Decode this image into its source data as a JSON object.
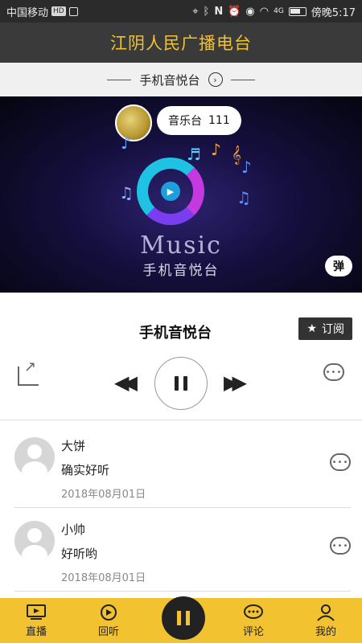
{
  "statusbar": {
    "carrier": "中国移动",
    "hd": "HD",
    "time": "傍晚5:17",
    "net": "4G"
  },
  "header": {
    "title": "江阴人民广播电台"
  },
  "subheader": {
    "title": "手机音悦台"
  },
  "banner": {
    "bubble_name": "音乐台",
    "bubble_count": "111",
    "logo_word": "Music",
    "logo_sub": "手机音悦台",
    "danmu": "弹"
  },
  "player": {
    "station": "手机音悦台",
    "subscribe_label": "订阅"
  },
  "comments": [
    {
      "name": "大饼",
      "text": "确实好听",
      "date": "2018年08月01日"
    },
    {
      "name": "小帅",
      "text": "好听哟",
      "date": "2018年08月01日"
    }
  ],
  "nav": {
    "live": "直播",
    "replay": "回听",
    "comment": "评论",
    "mine": "我的"
  },
  "colors": {
    "accent": "#f2c230",
    "header_bg": "#3a3a3a"
  }
}
